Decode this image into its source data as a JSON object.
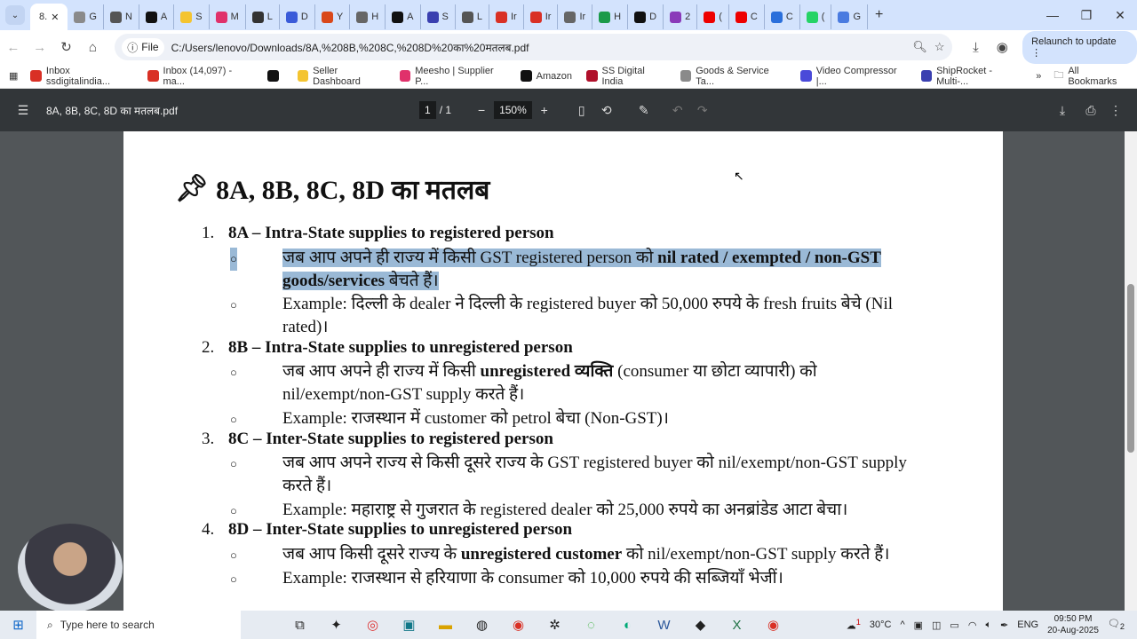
{
  "browser": {
    "active_tab": "8.",
    "tabs": [
      {
        "l": "G",
        "c": "#8a8a8a"
      },
      {
        "l": "N",
        "c": "#555"
      },
      {
        "l": "A",
        "c": "#111"
      },
      {
        "l": "S",
        "c": "#f4c430"
      },
      {
        "l": "M",
        "c": "#e0316b"
      },
      {
        "l": "L",
        "c": "#333"
      },
      {
        "l": "D",
        "c": "#3a5bd9"
      },
      {
        "l": "Y",
        "c": "#d9471a"
      },
      {
        "l": "H",
        "c": "#666"
      },
      {
        "l": "A",
        "c": "#111"
      },
      {
        "l": "S",
        "c": "#3a3fb0"
      },
      {
        "l": "L",
        "c": "#555"
      },
      {
        "l": "Ir",
        "c": "#d93025"
      },
      {
        "l": "Ir",
        "c": "#d93025"
      },
      {
        "l": "Ir",
        "c": "#666"
      },
      {
        "l": "H",
        "c": "#1a9a4a"
      },
      {
        "l": "D",
        "c": "#111"
      },
      {
        "l": "2",
        "c": "#8a3ab9"
      },
      {
        "l": "(",
        "c": "#e00"
      },
      {
        "l": "C",
        "c": "#e00"
      },
      {
        "l": "C",
        "c": "#2a6fdb"
      },
      {
        "l": "(",
        "c": "#25d366"
      },
      {
        "l": "G",
        "c": "#4a7be0"
      }
    ],
    "new_tab": "+",
    "file_chip": "File",
    "url": "C:/Users/lenovo/Downloads/8A,%208B,%208C,%208D%20का%20मतलब.pdf",
    "relaunch": "Relaunch to update",
    "bookmarks": [
      {
        "label": "Inbox ssdigitalindia...",
        "c": "#d93025"
      },
      {
        "label": "Inbox (14,097) - ma...",
        "c": "#d93025"
      },
      {
        "label": "",
        "c": "#111"
      },
      {
        "label": "Seller Dashboard",
        "c": "#f4c430"
      },
      {
        "label": "Meesho | Supplier P...",
        "c": "#e0316b"
      },
      {
        "label": "Amazon",
        "c": "#111"
      },
      {
        "label": "SS Digital India",
        "c": "#b0102a"
      },
      {
        "label": "Goods & Service Ta...",
        "c": "#8a8a8a"
      },
      {
        "label": "Video Compressor |...",
        "c": "#4a4ad9"
      },
      {
        "label": "ShipRocket - Multi-...",
        "c": "#3a3fb0"
      }
    ],
    "more_bookmarks": "»",
    "all_bookmarks": "All Bookmarks"
  },
  "pdf": {
    "filename": "8A, 8B, 8C, 8D का मतलब.pdf",
    "page_current": "1",
    "page_sep": "/",
    "page_total": "1",
    "zoom": "150%",
    "title": "8A, 8B, 8C, 8D का मतलब",
    "sections": [
      {
        "num": "1.",
        "head": "8A – Intra-State supplies to registered person",
        "bullets": [
          {
            "hl": true,
            "segs": [
              {
                "t": "जब आप अपने ही राज्य में किसी GST registered person को "
              },
              {
                "t": "nil rated / exempted / non-GST goods/services",
                "b": true
              },
              {
                "t": " बेचते हैं।"
              }
            ]
          },
          {
            "segs": [
              {
                "t": "Example: दिल्ली के dealer ने दिल्ली के registered buyer को 50,000 रुपये के fresh fruits बेचे (Nil rated)।"
              }
            ]
          }
        ]
      },
      {
        "num": "2.",
        "head": "8B – Intra-State supplies to unregistered person",
        "bullets": [
          {
            "segs": [
              {
                "t": "जब आप अपने ही राज्य में किसी "
              },
              {
                "t": "unregistered व्यक्ति",
                "b": true
              },
              {
                "t": " (consumer या छोटा व्यापारी) को nil/exempt/non-GST supply करते हैं।"
              }
            ]
          },
          {
            "segs": [
              {
                "t": "Example: राजस्थान में customer को petrol बेचा (Non-GST)।"
              }
            ]
          }
        ]
      },
      {
        "num": "3.",
        "head": "8C – Inter-State supplies to registered person",
        "bullets": [
          {
            "segs": [
              {
                "t": "जब आप अपने राज्य से किसी दूसरे राज्य के GST registered buyer को nil/exempt/non-GST supply करते हैं।"
              }
            ]
          },
          {
            "segs": [
              {
                "t": "Example: महाराष्ट्र से गुजरात के registered dealer को 25,000 रुपये का अनब्रांडेड आटा बेचा।"
              }
            ]
          }
        ]
      },
      {
        "num": "4.",
        "head": "8D – Inter-State supplies to unregistered person",
        "bullets": [
          {
            "segs": [
              {
                "t": "जब आप किसी दूसरे राज्य के "
              },
              {
                "t": "unregistered customer",
                "b": true
              },
              {
                "t": " को nil/exempt/non-GST supply करते हैं।"
              }
            ]
          },
          {
            "segs": [
              {
                "t": "Example: राजस्थान से हरियाणा के consumer को 10,000 रुपये की सब्जियाँ भेजीं।"
              }
            ]
          }
        ]
      }
    ]
  },
  "taskbar": {
    "search_placeholder": "Type here to search",
    "weather": "30°C",
    "weather_badge": "1",
    "lang": "ENG",
    "time": "09:50 PM",
    "date": "20-Aug-2025",
    "notif_count": "2"
  }
}
